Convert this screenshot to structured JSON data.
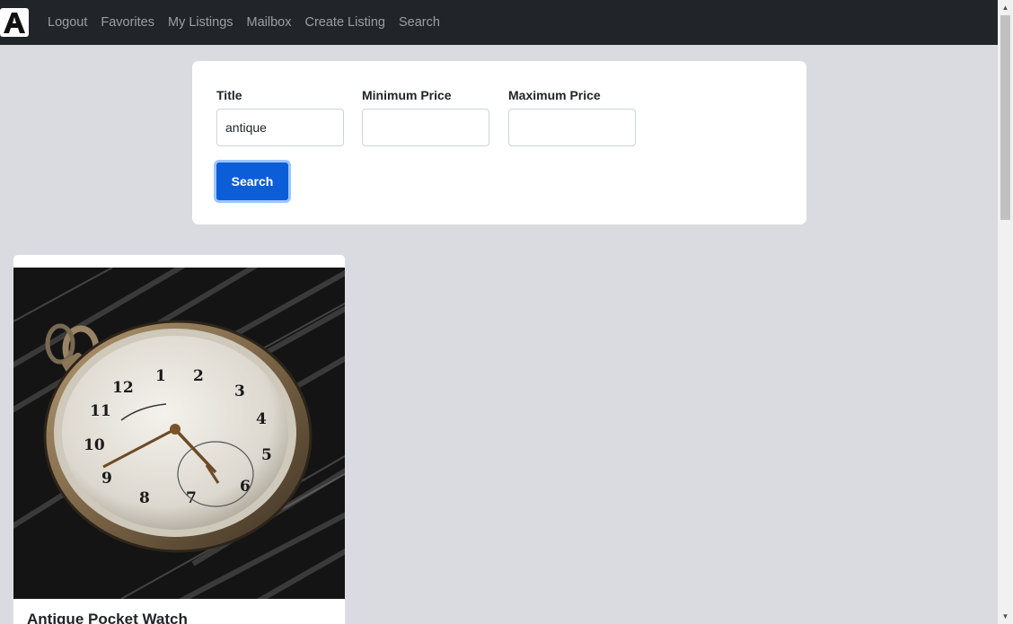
{
  "nav": {
    "logo_letter": "A",
    "links": [
      "Logout",
      "Favorites",
      "My Listings",
      "Mailbox",
      "Create Listing",
      "Search"
    ]
  },
  "search_form": {
    "title_label": "Title",
    "title_value": "antique",
    "min_price_label": "Minimum Price",
    "min_price_value": "",
    "max_price_label": "Maximum Price",
    "max_price_value": "",
    "search_button": "Search"
  },
  "results": [
    {
      "title": "Antique Pocket Watch",
      "image": "pocket-watch-photo"
    }
  ],
  "colors": {
    "navbar": "#212529",
    "page_bg": "#dadbe0",
    "primary": "#0b5ed7"
  },
  "scrollbar": {
    "up_icon": "scroll-up-arrow-icon",
    "down_icon": "scroll-down-arrow-icon"
  }
}
